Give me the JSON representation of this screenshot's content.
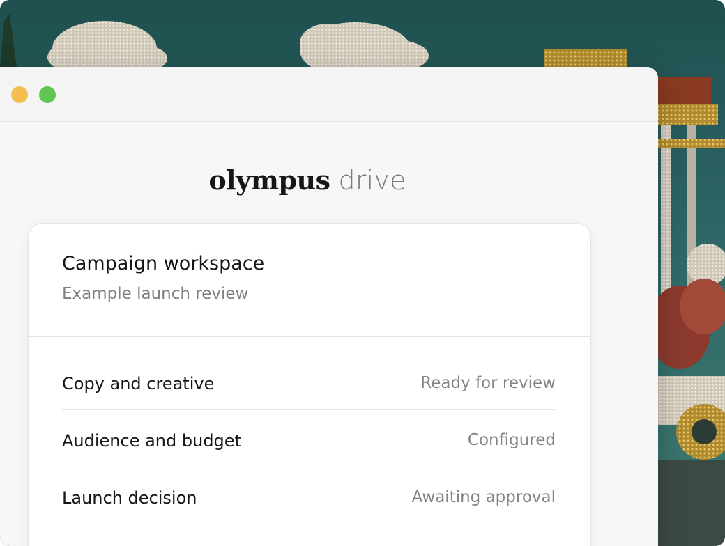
{
  "window": {
    "traffic_lights": [
      {
        "name": "minimize",
        "color": "#f4bf4f"
      },
      {
        "name": "maximize",
        "color": "#61c554"
      }
    ]
  },
  "logo": {
    "brand": "olympus",
    "product": "drive"
  },
  "card": {
    "title": "Campaign workspace",
    "subtitle": "Example launch review",
    "items": [
      {
        "label": "Copy and creative",
        "status": "Ready for review"
      },
      {
        "label": "Audience and budget",
        "status": "Configured"
      },
      {
        "label": "Launch decision",
        "status": "Awaiting approval"
      }
    ]
  },
  "colors": {
    "backdrop_sky": "#2f6b6a",
    "window_bg": "#f7f7f7",
    "card_bg": "#ffffff",
    "muted_text": "#808080"
  }
}
